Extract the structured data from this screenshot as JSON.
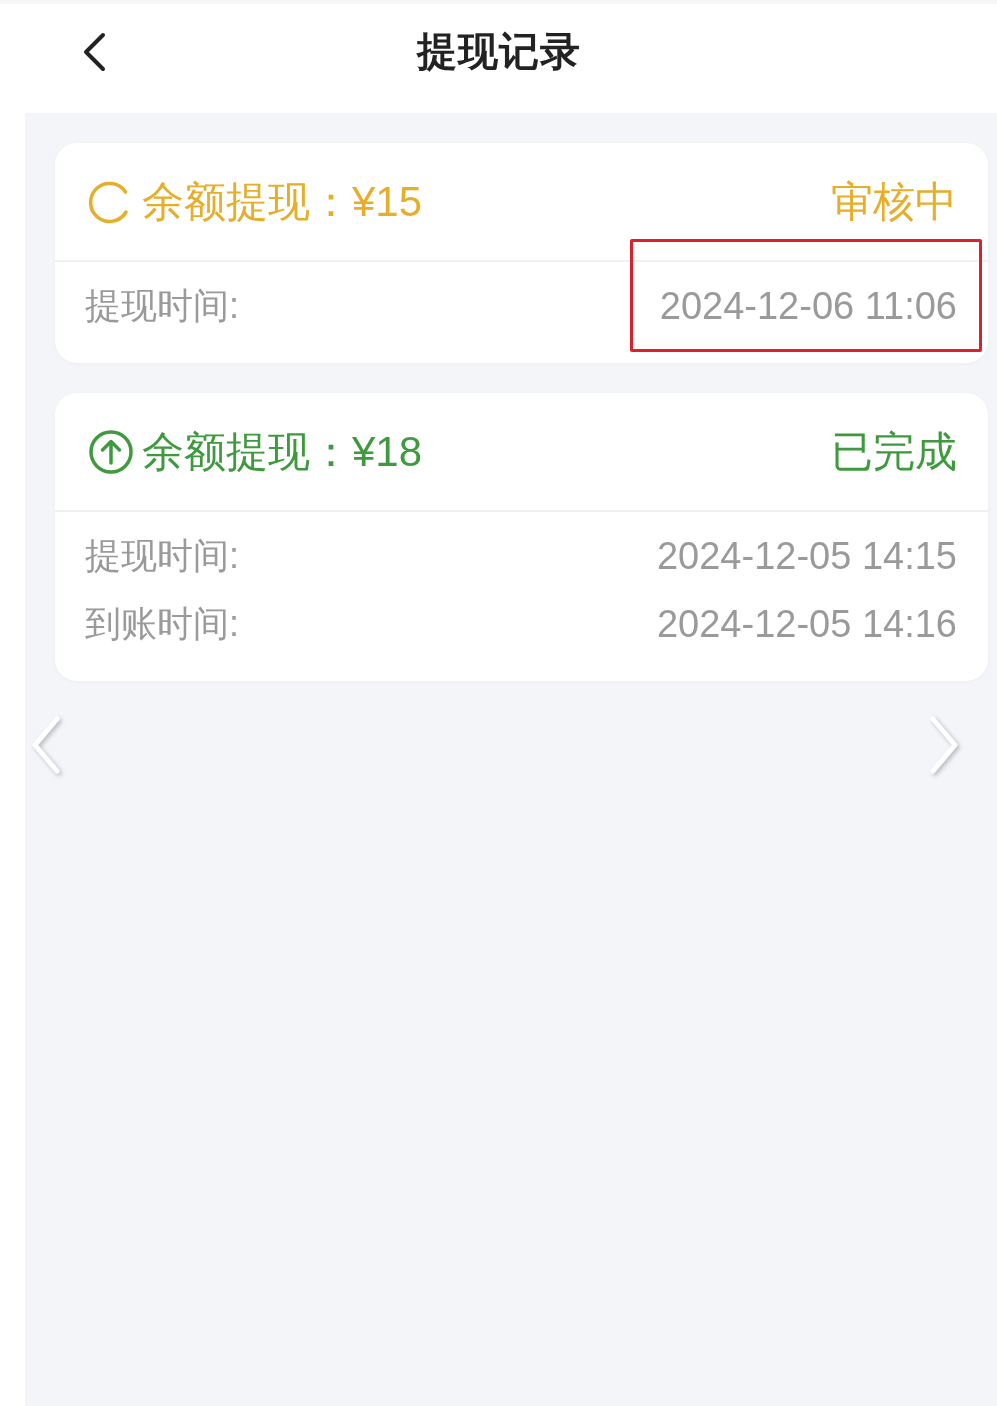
{
  "header": {
    "title": "提现记录"
  },
  "records": [
    {
      "kind": "pending",
      "title": "余额提现：¥15",
      "status": "审核中",
      "rows": [
        {
          "label": "提现时间:",
          "value": "2024-12-06 11:06",
          "highlighted": true
        }
      ]
    },
    {
      "kind": "completed",
      "title": "余额提现：¥18",
      "status": "已完成",
      "rows": [
        {
          "label": "提现时间:",
          "value": "2024-12-05 14:15",
          "highlighted": false
        },
        {
          "label": "到账时间:",
          "value": "2024-12-05 14:16",
          "highlighted": false
        }
      ]
    }
  ]
}
